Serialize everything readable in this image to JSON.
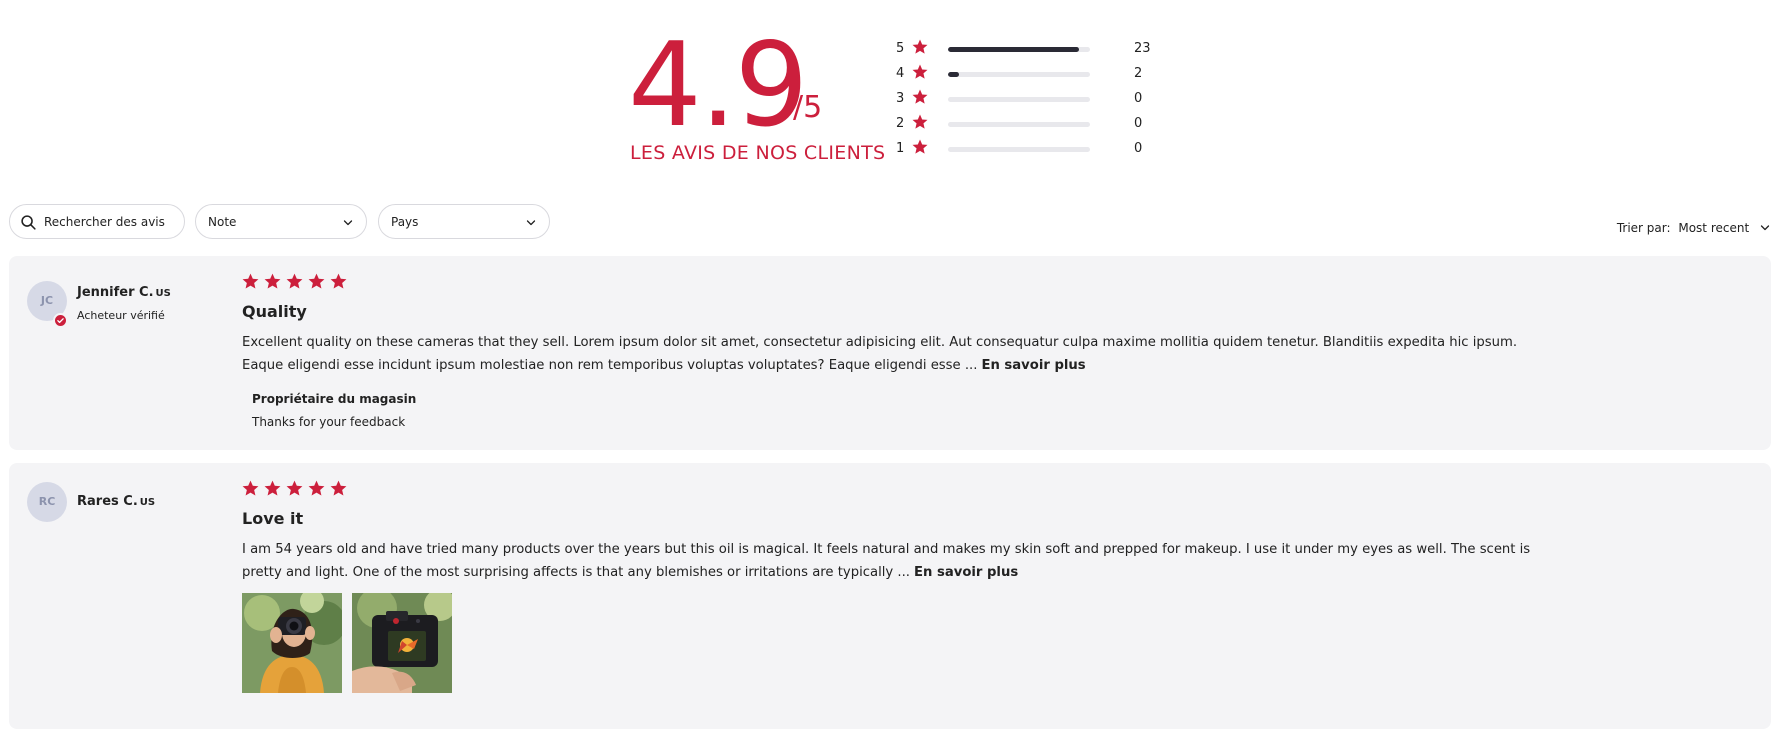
{
  "summary": {
    "score": "4.9",
    "score_max": "/5",
    "label": "LES AVIS DE NOS CLIENTS",
    "accent_color": "#cc1f3c",
    "distribution": [
      {
        "stars": "5",
        "count": "23",
        "fill_fraction": 0.92
      },
      {
        "stars": "4",
        "count": "2",
        "fill_fraction": 0.08
      },
      {
        "stars": "3",
        "count": "0",
        "fill_fraction": 0
      },
      {
        "stars": "2",
        "count": "0",
        "fill_fraction": 0
      },
      {
        "stars": "1",
        "count": "0",
        "fill_fraction": 0
      }
    ]
  },
  "filters": {
    "search_placeholder": "Rechercher des avis",
    "rating_select": "Note",
    "country_select": "Pays",
    "sort_label": "Trier par:",
    "sort_value": "Most recent"
  },
  "reviews": [
    {
      "initials": "JC",
      "name": "Jennifer C.",
      "country": "US",
      "verified_text": "Acheteur vérifié",
      "rating": 5,
      "title": "Quality",
      "body": "Excellent quality on these cameras that they sell. Lorem ipsum dolor sit amet, consectetur adipisicing elit. Aut consequatur culpa maxime mollitia quidem tenetur. Blanditiis expedita hic ipsum. Eaque eligendi esse incidunt ipsum molestiae non rem temporibus voluptas voluptates? Eaque eligendi esse ...",
      "read_more": "En savoir plus",
      "owner_reply_title": "Propriétaire du magasin",
      "owner_reply_text": "Thanks for your feedback"
    },
    {
      "initials": "RC",
      "name": "Rares C.",
      "country": "US",
      "rating": 5,
      "title": "Love it",
      "body": "I am 54 years old and have tried many products over the years but this oil is magical. It feels natural and makes my skin soft and prepped for makeup. I use it under my eyes as well. The scent is pretty and light. One of the most surprising affects is that any blemishes or irritations are typically ...",
      "read_more": "En savoir plus",
      "photos": [
        "woman-with-camera-photo",
        "camera-screen-flower-photo"
      ]
    }
  ]
}
